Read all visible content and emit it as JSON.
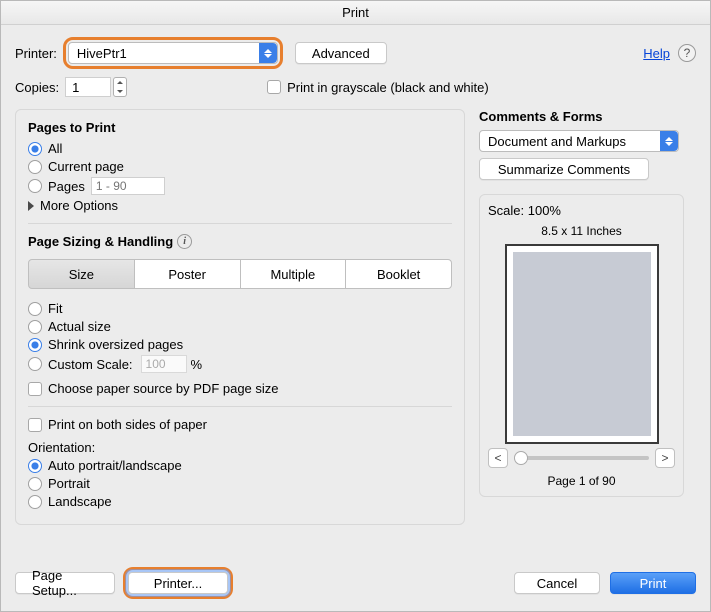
{
  "title": "Print",
  "top": {
    "printer_label": "Printer:",
    "printer_value": "HivePtr1",
    "advanced": "Advanced",
    "help": "Help",
    "copies_label": "Copies:",
    "copies_value": "1",
    "grayscale": "Print in grayscale (black and white)"
  },
  "pages": {
    "header": "Pages to Print",
    "all": "All",
    "current": "Current page",
    "pages": "Pages",
    "range_placeholder": "1 - 90",
    "more": "More Options"
  },
  "sizing": {
    "header": "Page Sizing & Handling",
    "seg": [
      "Size",
      "Poster",
      "Multiple",
      "Booklet"
    ],
    "fit": "Fit",
    "actual": "Actual size",
    "shrink": "Shrink oversized pages",
    "custom": "Custom Scale:",
    "custom_value": "100",
    "percent": "%",
    "choose_source": "Choose paper source by PDF page size",
    "duplex": "Print on both sides of paper",
    "orientation": "Orientation:",
    "auto": "Auto portrait/landscape",
    "portrait": "Portrait",
    "landscape": "Landscape"
  },
  "right": {
    "comments_header": "Comments & Forms",
    "comments_value": "Document and Markups",
    "summarize": "Summarize Comments",
    "scale": "Scale: 100%",
    "paper": "8.5 x 11 Inches",
    "pager": "Page 1 of 90"
  },
  "bottom": {
    "page_setup": "Page Setup...",
    "printer": "Printer...",
    "cancel": "Cancel",
    "print": "Print"
  }
}
